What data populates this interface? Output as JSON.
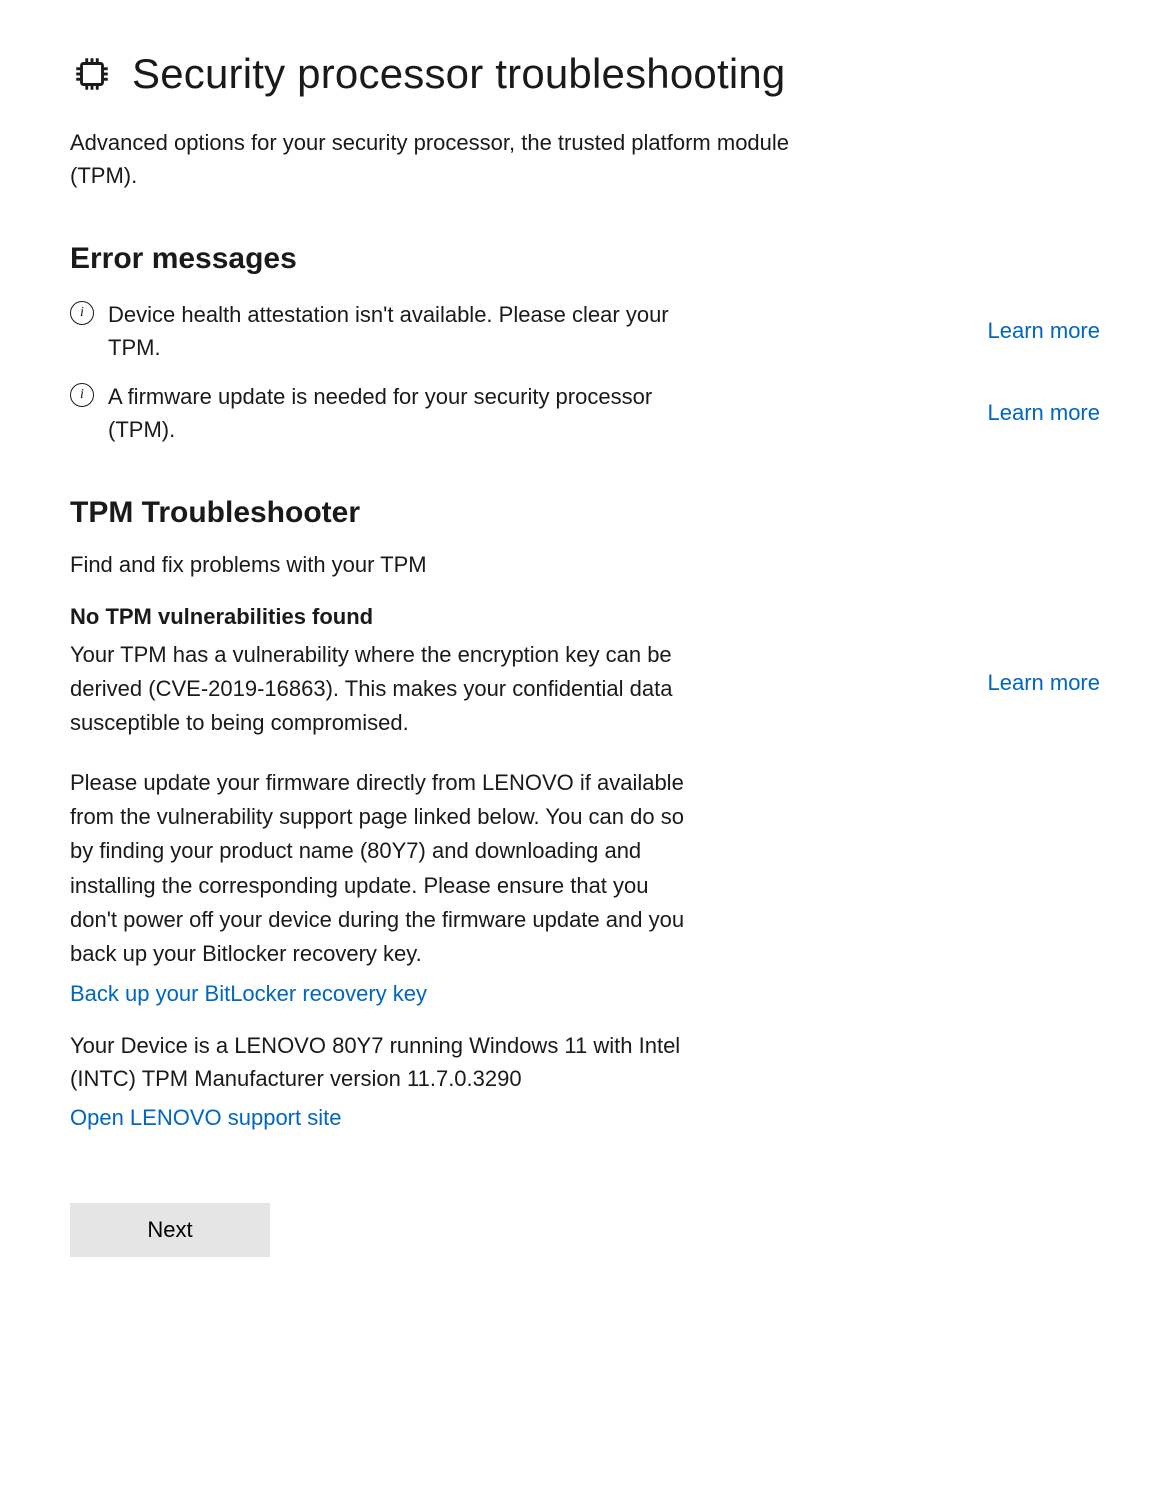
{
  "header": {
    "title": "Security processor troubleshooting",
    "subtitle": "Advanced options for your security processor, the trusted platform module (TPM)."
  },
  "errors": {
    "heading": "Error messages",
    "items": [
      {
        "message": "Device health attestation isn't available. Please clear your TPM.",
        "link_label": "Learn more"
      },
      {
        "message": "A firmware update is needed for your security processor (TPM).",
        "link_label": "Learn more"
      }
    ]
  },
  "troubleshooter": {
    "heading": "TPM Troubleshooter",
    "subtitle": "Find and fix problems with your TPM",
    "status_heading": "No TPM vulnerabilities found",
    "vuln_text": "Your TPM has a vulnerability where the encryption key can be derived (CVE-2019-16863). This makes your confidential data susceptible to being compromised.",
    "learn_more": "Learn more",
    "update_text": "Please update your firmware directly from LENOVO if available from the vulnerability support page linked below. You can do so by finding your product name (80Y7) and downloading and installing the corresponding update. Please ensure that you don't power off your device during the firmware update and you back up your Bitlocker recovery key.",
    "backup_link": "Back up your BitLocker recovery key",
    "device_info": "Your Device is a LENOVO 80Y7 running Windows 11 with Intel (INTC) TPM Manufacturer version 11.7.0.3290",
    "support_link": "Open LENOVO support site"
  },
  "actions": {
    "next": "Next"
  }
}
